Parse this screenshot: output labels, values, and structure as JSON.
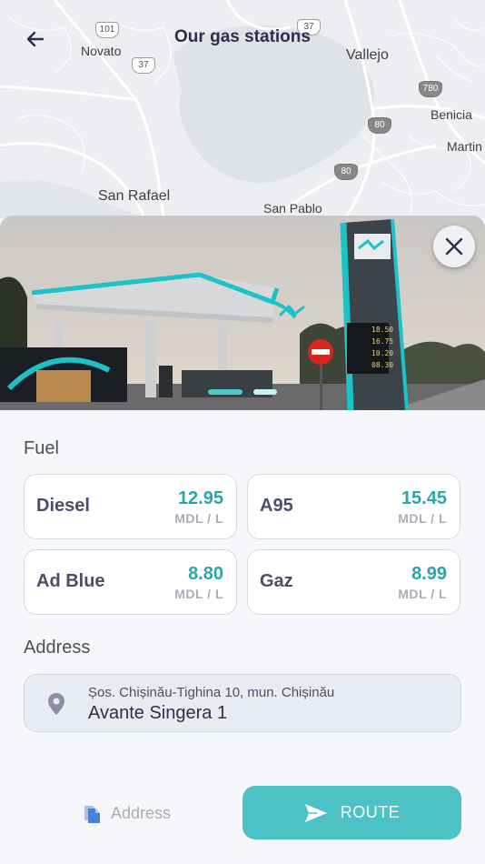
{
  "header": {
    "title": "Our gas stations",
    "back_icon": "arrow-left-icon"
  },
  "map": {
    "labels": {
      "novato": "Novato",
      "vallejo": "Vallejo",
      "benicia": "Benicia",
      "martin": "Martin",
      "san_rafael": "San Rafael",
      "san_pablo": "San Pablo"
    },
    "shields": {
      "us101": "101",
      "r37a": "37",
      "r37b": "37",
      "i780": "780",
      "i80a": "80",
      "i80b": "80"
    }
  },
  "gallery": {
    "close_icon": "close-icon",
    "slides_total": 2,
    "active_slide": 1,
    "sign_prices": [
      "18.50",
      "16.75",
      "10.20",
      "08.30"
    ]
  },
  "fuel": {
    "label": "Fuel",
    "items": [
      {
        "name": "Diesel",
        "price": "12.95",
        "unit": "MDL / L"
      },
      {
        "name": "A95",
        "price": "15.45",
        "unit": "MDL / L"
      },
      {
        "name": "Ad Blue",
        "price": "8.80",
        "unit": "MDL / L"
      },
      {
        "name": "Gaz",
        "price": "8.99",
        "unit": "MDL / L"
      }
    ]
  },
  "address": {
    "label": "Address",
    "street": "Șos. Chișinău-Tighina 10, mun. Chișinău",
    "name": "Avante Singera 1",
    "icon": "location-pin-icon"
  },
  "actions": {
    "copy_label": "Address",
    "copy_icon": "copy-document-icon",
    "route_label": "ROUTE",
    "route_icon": "send-arrow-icon"
  },
  "colors": {
    "accent": "#4ac2c6",
    "price": "#2aa6a8",
    "title": "#2c2f4a"
  }
}
